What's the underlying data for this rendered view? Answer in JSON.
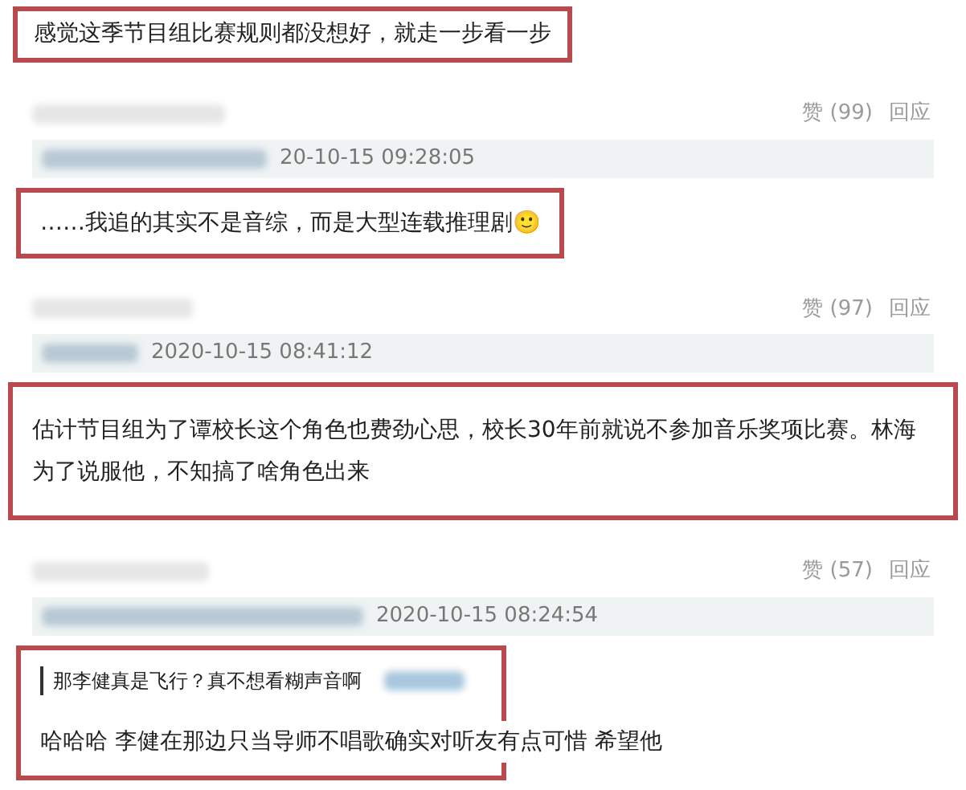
{
  "top_reply": {
    "text": "感觉这季节目组比赛规则都没想好，就走一步看一步"
  },
  "comments": [
    {
      "likes": "赞 (99)",
      "reply": "回应",
      "time": "20-10-15 09:28:05",
      "text": "……我追的其实不是音综，而是大型连载推理剧🙂"
    },
    {
      "likes": "赞 (97)",
      "reply": "回应",
      "time": "2020-10-15 08:41:12",
      "text": "估计节目组为了谭校长这个角色也费劲心思，校长30年前就说不参加音乐奖项比赛。林海为了说服他，不知搞了啥角色出来"
    },
    {
      "likes": "赞 (57)",
      "reply": "回应",
      "time": "2020-10-15 08:24:54",
      "quote": "那李健真是飞行？真不想看糊声音啊",
      "text": "哈哈哈 李健在那边只当导师不唱歌确实对听友有点可惜 希望他"
    }
  ]
}
